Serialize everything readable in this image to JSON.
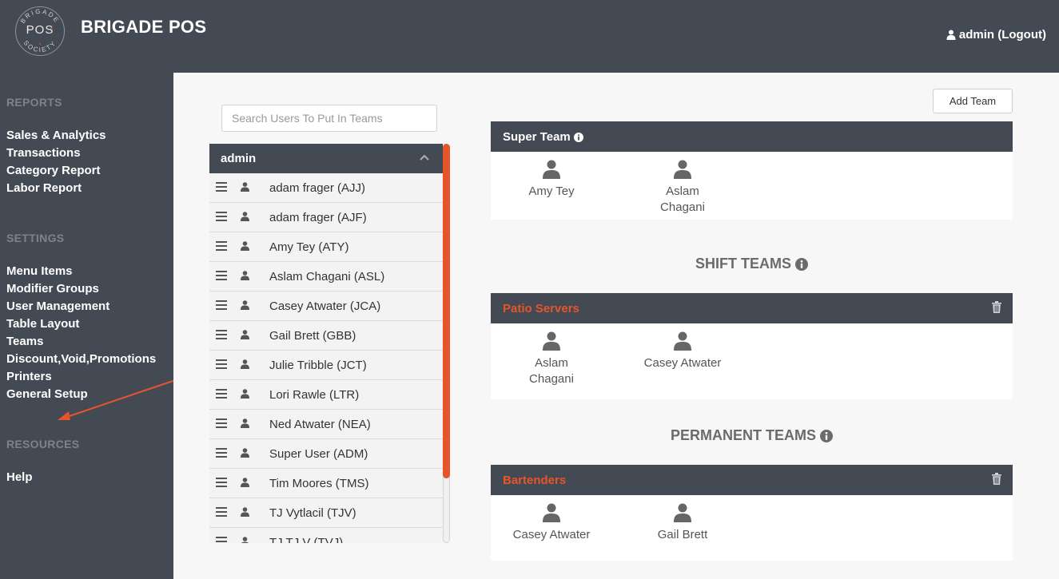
{
  "header": {
    "logo_text": "POS",
    "logo_ring_top": "BRIGADE",
    "logo_ring_bottom": "SOCIETY",
    "title": "BRIGADE POS",
    "user_link": "admin (Logout)"
  },
  "sidebar": {
    "reports_title": "REPORTS",
    "reports": [
      "Sales & Analytics",
      "Transactions",
      "Category Report",
      "Labor Report"
    ],
    "settings_title": "SETTINGS",
    "settings": [
      "Menu Items",
      "Modifier Groups",
      "User Management",
      "Table Layout",
      "Teams",
      "Discount,Void,Promotions",
      "Printers",
      "General Setup"
    ],
    "resources_title": "RESOURCES",
    "resources": [
      "Help"
    ]
  },
  "search": {
    "placeholder": "Search Users To Put In Teams"
  },
  "user_list": {
    "header": "admin",
    "users": [
      "adam frager (AJJ)",
      "adam frager (AJF)",
      "Amy Tey (ATY)",
      "Aslam Chagani (ASL)",
      "Casey Atwater (JCA)",
      "Gail Brett (GBB)",
      "Julie Tribble (JCT)",
      "Lori Rawle (LTR)",
      "Ned Atwater (NEA)",
      "Super User (ADM)",
      "Tim Moores (TMS)",
      "TJ Vytlacil (TJV)",
      "TJ TJ V (TVJ)"
    ]
  },
  "add_team_label": "Add Team",
  "super_team": {
    "name": "Super Team",
    "members": [
      [
        "Amy Tey"
      ],
      [
        "Aslam",
        "Chagani"
      ]
    ]
  },
  "shift_teams_title": "SHIFT TEAMS",
  "patio_servers": {
    "name": "Patio Servers",
    "members": [
      [
        "Aslam",
        "Chagani"
      ],
      [
        "Casey Atwater"
      ]
    ]
  },
  "permanent_teams_title": "PERMANENT TEAMS",
  "bartenders": {
    "name": "Bartenders",
    "members": [
      [
        "Casey Atwater"
      ],
      [
        "Gail Brett"
      ]
    ]
  },
  "colors": {
    "dark": "#434a54",
    "accent": "#e8542a",
    "panel": "#f7f7f7"
  }
}
